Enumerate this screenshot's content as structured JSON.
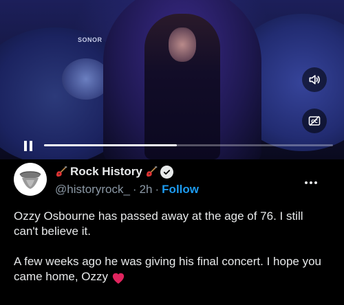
{
  "video": {
    "brand_text": "SONOR",
    "progress_fraction": 0.46,
    "volume_icon": "speaker-icon",
    "captions_icon": "cc-icon",
    "pause_icon": "pause-icon"
  },
  "tweet": {
    "author": {
      "display_name": "Rock History",
      "handle": "@historyrock_",
      "avatar_icon": "rolling-stones-tongue-logo",
      "verified": true,
      "name_emoji": "guitar-icon"
    },
    "separator": "·",
    "timestamp": "2h",
    "follow_label": "Follow",
    "text_line1": "Ozzy Osbourne has passed away at the age of 76. I still can't believe it.",
    "text_line2": "A few weeks ago he was giving his final concert. I hope you came home, Ozzy",
    "heart_emoji": "heart-icon"
  },
  "colors": {
    "background": "#000000",
    "text": "#e7e9ea",
    "secondary_text": "#8b98a5",
    "accent": "#1d9bf0",
    "heart": "#f91880"
  }
}
